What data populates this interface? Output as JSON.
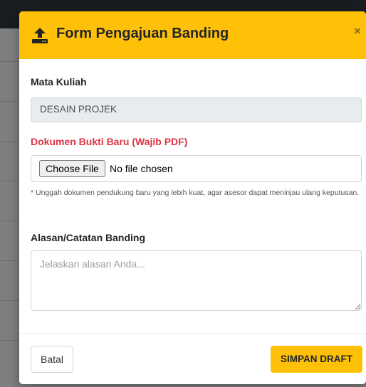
{
  "modal": {
    "title": "Form Pengajuan Banding",
    "close_label": "×",
    "header_icon": "upload-icon"
  },
  "course": {
    "label": "Mata Kuliah",
    "value": "DESAIN PROJEK"
  },
  "document": {
    "label": "Dokumen Bukti Baru (Wajib PDF)",
    "button_label": "Choose File",
    "status": "No file chosen",
    "hint": "* Unggah dokumen pendukung baru yang lebih kuat, agar asesor dapat meninjau ulang keputusan."
  },
  "reason": {
    "label": "Alasan/Catatan Banding",
    "placeholder": "Jelaskan alasan Anda..."
  },
  "footer": {
    "cancel_label": "Batal",
    "save_label": "SIMPAN DRAFT"
  },
  "colors": {
    "accent": "#ffc107",
    "required_label": "#dc3545"
  }
}
